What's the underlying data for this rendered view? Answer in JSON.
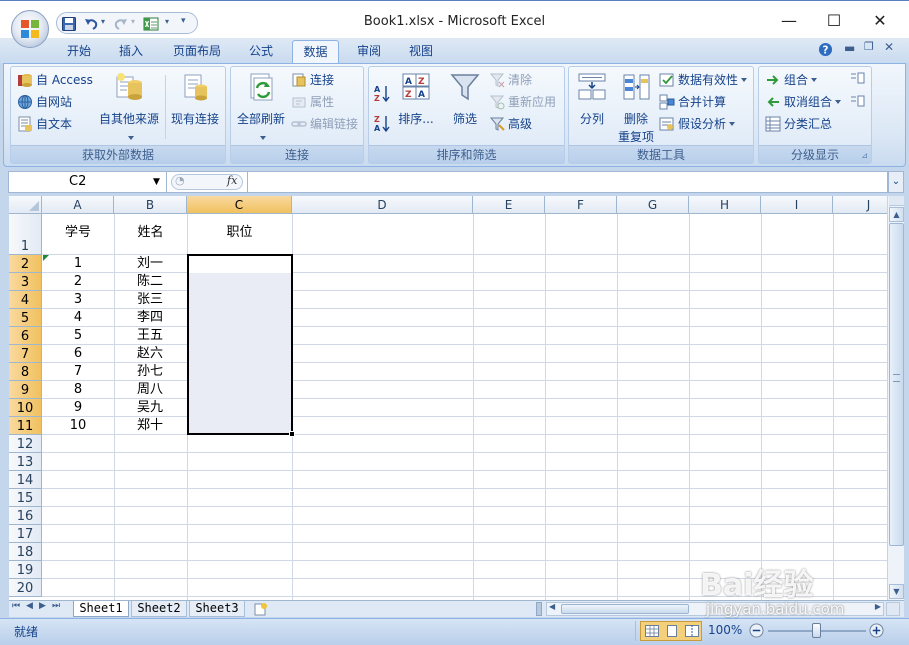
{
  "window": {
    "title": "Book1.xlsx - Microsoft Excel",
    "minimize_glyph": "—",
    "maximize_glyph": "☐",
    "close_glyph": "✕"
  },
  "tabs": [
    {
      "label": "开始"
    },
    {
      "label": "插入"
    },
    {
      "label": "页面布局"
    },
    {
      "label": "公式"
    },
    {
      "label": "数据",
      "active": true
    },
    {
      "label": "审阅"
    },
    {
      "label": "视图"
    }
  ],
  "ribbon": {
    "external": {
      "title": "获取外部数据",
      "access": "自 Access",
      "web": "自网站",
      "text": "自文本",
      "other": "自其他来源",
      "existing": "现有连接"
    },
    "connections": {
      "title": "连接",
      "refresh_all": "全部刷新",
      "connections": "连接",
      "properties": "属性",
      "edit_links": "编辑链接"
    },
    "sort_filter": {
      "title": "排序和筛选",
      "sort": "排序...",
      "filter": "筛选",
      "clear": "清除",
      "reapply": "重新应用",
      "advanced": "高级"
    },
    "data_tools": {
      "title": "数据工具",
      "text_to_columns": "分列",
      "remove_dup_1": "删除",
      "remove_dup_2": "重复项",
      "validation": "数据有效性",
      "consolidate": "合并计算",
      "what_if": "假设分析"
    },
    "outline": {
      "title": "分级显示",
      "group": "组合",
      "ungroup": "取消组合",
      "subtotal": "分类汇总"
    }
  },
  "formula_bar": {
    "name_box": "C2",
    "fx": "fx",
    "content": ""
  },
  "columns": [
    "A",
    "B",
    "C",
    "D",
    "E",
    "F",
    "G",
    "H",
    "I",
    "J"
  ],
  "rows": [
    "1",
    "2",
    "3",
    "4",
    "5",
    "6",
    "7",
    "8",
    "9",
    "10",
    "11",
    "12",
    "13",
    "14",
    "15",
    "16",
    "17",
    "18",
    "19",
    "20"
  ],
  "sheet": {
    "headers": [
      "学号",
      "姓名",
      "职位"
    ],
    "records": [
      [
        "1",
        "刘一"
      ],
      [
        "2",
        "陈二"
      ],
      [
        "3",
        "张三"
      ],
      [
        "4",
        "李四"
      ],
      [
        "5",
        "王五"
      ],
      [
        "6",
        "赵六"
      ],
      [
        "7",
        "孙七"
      ],
      [
        "8",
        "周八"
      ],
      [
        "9",
        "吴九"
      ],
      [
        "10",
        "郑十"
      ]
    ],
    "selection": "C2:C11"
  },
  "sheet_tabs": [
    "Sheet1",
    "Sheet2",
    "Sheet3"
  ],
  "status": {
    "ready": "就绪",
    "zoom": "100%"
  },
  "watermark": {
    "brand": "Bai经验",
    "url": "jingyan.baidu.com"
  },
  "colors": {
    "accent": "#15428b",
    "selection_fill": "#e9ebf5",
    "header_selected": "#f1c15f"
  }
}
